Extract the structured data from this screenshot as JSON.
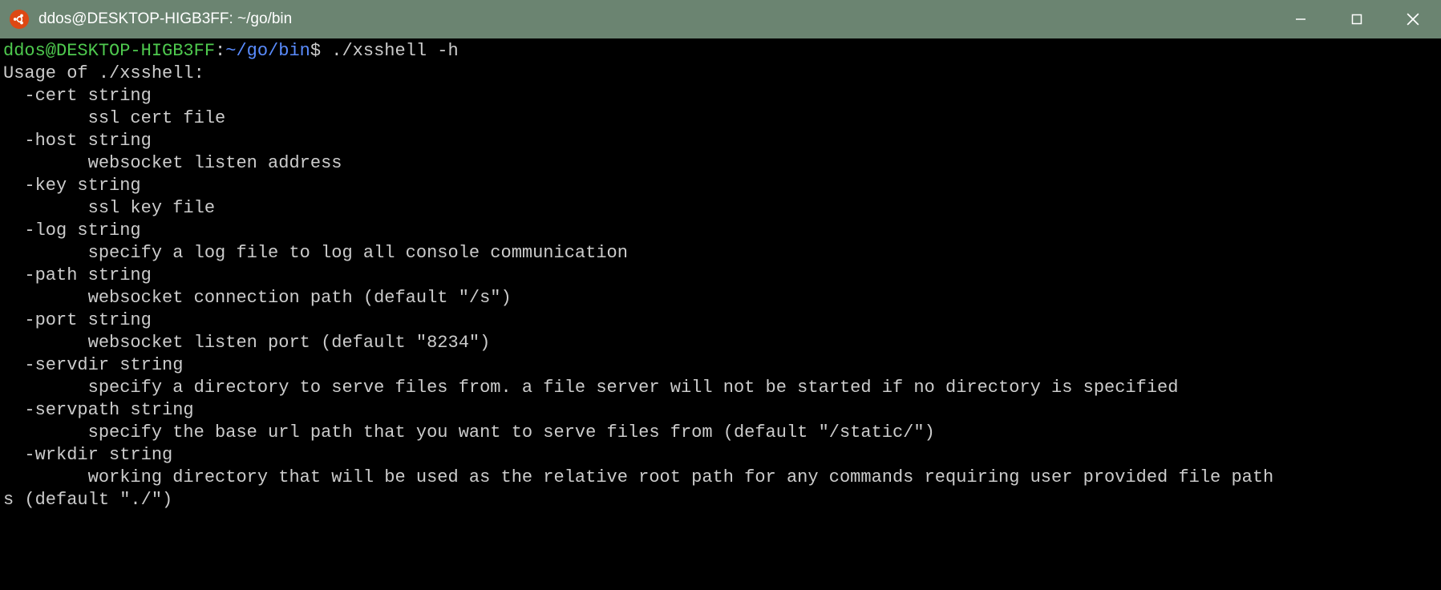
{
  "window": {
    "title": "ddos@DESKTOP-HIGB3FF: ~/go/bin"
  },
  "prompt": {
    "user_host": "ddos@DESKTOP-HIGB3FF",
    "colon": ":",
    "path": "~/go/bin",
    "symbol": "$",
    "command": " ./xsshell -h"
  },
  "output": {
    "l0": "Usage of ./xsshell:",
    "l1": "  -cert string",
    "l2": "        ssl cert file",
    "l3": "  -host string",
    "l4": "        websocket listen address",
    "l5": "  -key string",
    "l6": "        ssl key file",
    "l7": "  -log string",
    "l8": "        specify a log file to log all console communication",
    "l9": "  -path string",
    "l10": "        websocket connection path (default \"/s\")",
    "l11": "  -port string",
    "l12": "        websocket listen port (default \"8234\")",
    "l13": "  -servdir string",
    "l14": "        specify a directory to serve files from. a file server will not be started if no directory is specified",
    "l15": "  -servpath string",
    "l16": "        specify the base url path that you want to serve files from (default \"/static/\")",
    "l17": "  -wrkdir string",
    "l18": "        working directory that will be used as the relative root path for any commands requiring user provided file path",
    "l19": "s (default \"./\")"
  }
}
